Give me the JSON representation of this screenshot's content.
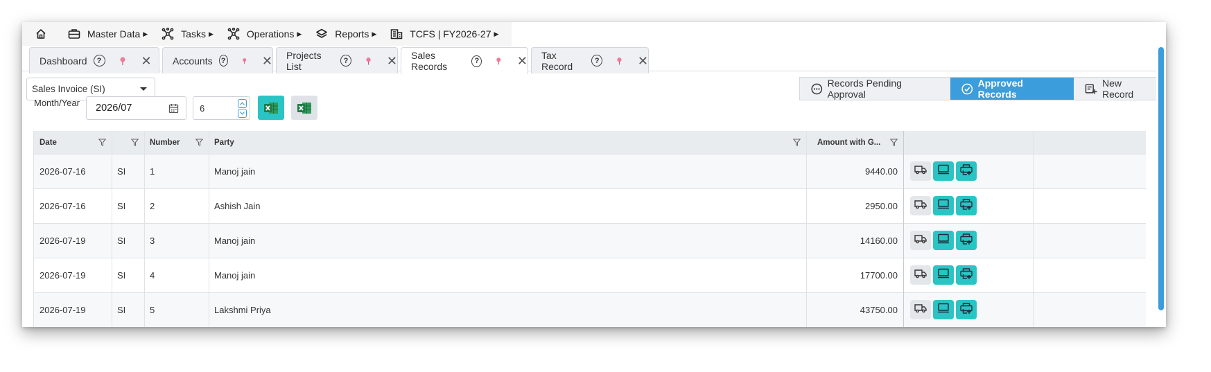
{
  "menu": {
    "items": [
      {
        "label": "Master Data",
        "icon": "briefcase-icon"
      },
      {
        "label": "Tasks",
        "icon": "network-icon"
      },
      {
        "label": "Operations",
        "icon": "network-icon"
      },
      {
        "label": "Reports",
        "icon": "layers-icon"
      },
      {
        "label": "TCFS | FY2026-27",
        "icon": "building-icon"
      }
    ],
    "caret": "▶"
  },
  "tabs": [
    {
      "label": "Dashboard",
      "active": false
    },
    {
      "label": "Accounts",
      "active": false
    },
    {
      "label": "Projects List",
      "active": false
    },
    {
      "label": "Sales Records",
      "active": true
    },
    {
      "label": "Tax Record",
      "active": false
    }
  ],
  "tab_help": "?",
  "tab_close": "✕",
  "voucher_type": {
    "selected": "Sales Invoice (SI)"
  },
  "record_buttons": {
    "pending": "Records Pending Approval",
    "approved": "Approved Records",
    "new": "New Record"
  },
  "filters": {
    "month_year_label": "Month/Year",
    "month_year_value": "2026/07",
    "number_value": "6"
  },
  "grid": {
    "columns": [
      "Date",
      "",
      "Number",
      "Party",
      "Amount with G..."
    ],
    "rows": [
      {
        "date": "2026-07-16",
        "type": "SI",
        "number": "1",
        "party": "Manoj jain",
        "amount": "9440.00"
      },
      {
        "date": "2026-07-16",
        "type": "SI",
        "number": "2",
        "party": "Ashish Jain",
        "amount": "2950.00"
      },
      {
        "date": "2026-07-19",
        "type": "SI",
        "number": "3",
        "party": "Manoj jain",
        "amount": "14160.00"
      },
      {
        "date": "2026-07-19",
        "type": "SI",
        "number": "4",
        "party": "Manoj jain",
        "amount": "17700.00"
      },
      {
        "date": "2026-07-19",
        "type": "SI",
        "number": "5",
        "party": "Lakshmi Priya",
        "amount": "43750.00"
      }
    ]
  },
  "colors": {
    "accent": "#3b9ddb",
    "teal": "#2bc4c4",
    "pin": "#f07a9a",
    "excel_green": "#1e7b45"
  }
}
